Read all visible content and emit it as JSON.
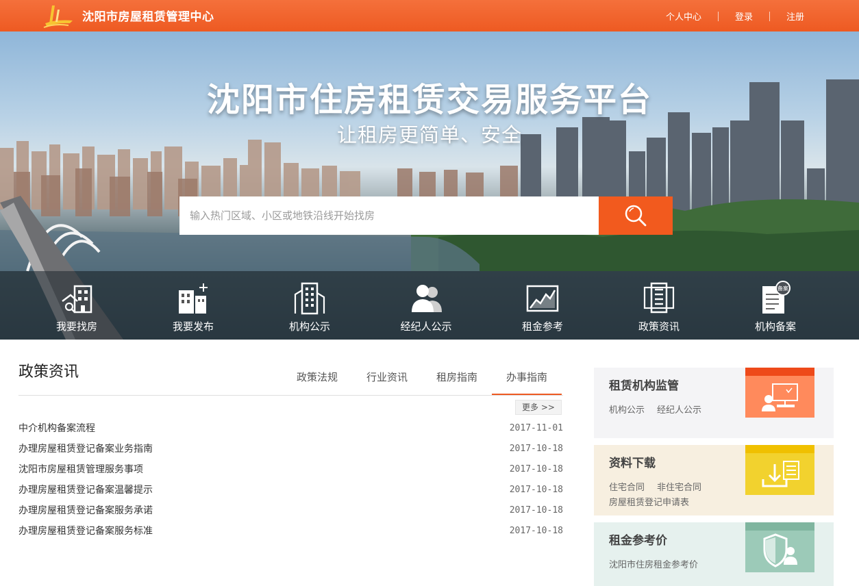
{
  "header": {
    "site_title": "沈阳市房屋租赁管理中心",
    "nav": {
      "personal": "个人中心",
      "login": "登录",
      "register": "注册"
    }
  },
  "hero": {
    "title": "沈阳市住房租赁交易服务平台",
    "subtitle": "让租房更简单、安全",
    "search_placeholder": "输入热门区域、小区或地铁沿线开始找房"
  },
  "quick_links": [
    {
      "label": "我要找房",
      "icon": "house-search-icon"
    },
    {
      "label": "我要发布",
      "icon": "building-plus-icon"
    },
    {
      "label": "机构公示",
      "icon": "office-building-icon"
    },
    {
      "label": "经纪人公示",
      "icon": "people-icon"
    },
    {
      "label": "租金参考",
      "icon": "line-chart-icon"
    },
    {
      "label": "政策资讯",
      "icon": "document-list-icon"
    },
    {
      "label": "机构备案",
      "icon": "filing-document-icon"
    }
  ],
  "quick_link_badge": "备案",
  "news": {
    "title": "政策资讯",
    "tabs": [
      "政策法规",
      "行业资讯",
      "租房指南",
      "办事指南"
    ],
    "active_tab": "办事指南",
    "more": "更多 >>",
    "items": [
      {
        "title": "中介机构备案流程",
        "date": "2017-11-01"
      },
      {
        "title": "办理房屋租赁登记备案业务指南",
        "date": "2017-10-18"
      },
      {
        "title": "沈阳市房屋租赁管理服务事项",
        "date": "2017-10-18"
      },
      {
        "title": "办理房屋租赁登记备案温馨提示",
        "date": "2017-10-18"
      },
      {
        "title": "办理房屋租赁登记备案服务承诺",
        "date": "2017-10-18"
      },
      {
        "title": "办理房屋租赁登记备案服务标准",
        "date": "2017-10-18"
      }
    ]
  },
  "cards": [
    {
      "title": "租赁机构监管",
      "links": [
        "机构公示",
        "经纪人公示"
      ],
      "icon": "computer-user-icon",
      "bg": "#f4f4f6",
      "accent": "#ff8a5c",
      "band": "#ee4a1a"
    },
    {
      "title": "资料下载",
      "links": [
        "住宅合同",
        "非住宅合同",
        "房屋租赁登记申请表"
      ],
      "icon": "download-icon",
      "bg": "#f7efe0",
      "accent": "#f2d22e",
      "band": "#f0c000"
    },
    {
      "title": "租金参考价",
      "links": [
        "沈阳市住房租金参考价"
      ],
      "icon": "shield-user-icon",
      "bg": "#e6f1ee",
      "accent": "#9ccab8",
      "band": "#7fb59f"
    }
  ],
  "colors": {
    "brand": "#ee5a22",
    "search_button": "#f25a1e"
  }
}
